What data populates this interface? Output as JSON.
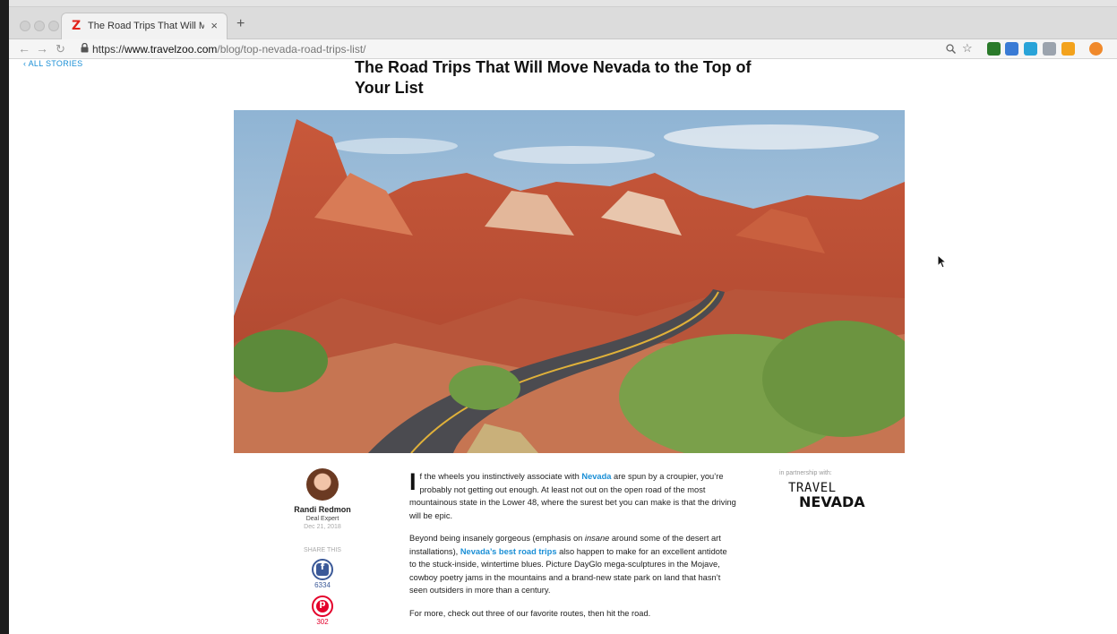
{
  "browser": {
    "tab": {
      "title": "The Road Trips That Will Move",
      "favicon": "Z",
      "close": "×"
    },
    "new_tab": "+",
    "url": {
      "scheme": "https://",
      "host": "www.travelzoo.com",
      "path": "/blog/top-nevada-road-trips-list/"
    }
  },
  "page": {
    "back_link": "ALL STORIES",
    "title": "The Road Trips That Will Move Nevada to the Top of Your List",
    "author": {
      "name": "Randi Redmon",
      "role": "Deal Expert",
      "date": "Dec 21, 2018"
    },
    "share": {
      "label": "SHARE THIS",
      "facebook_count": "6334",
      "pinterest_count": "302"
    },
    "paragraphs": {
      "p1": {
        "dropcap": "I",
        "before": "f the wheels you instinctively associate with ",
        "link": "Nevada",
        "after": " are spun by a croupier, you’re probably not getting out enough. At least not out on the open road of the most mountainous state in the Lower 48, where the surest bet you can make is that the driving will be epic."
      },
      "p2": {
        "before": "Beyond being insanely gorgeous (emphasis on ",
        "em": "insane",
        "mid": " around some of the desert art installations), ",
        "link": "Nevada’s best road trips",
        "after": " also happen to make for an excellent antidote to the stuck-inside, wintertime blues. Picture DayGlo mega-sculptures in the Mojave, cowboy poetry jams in the mountains and a brand-new state park on land that hasn’t seen outsiders in more than a century."
      },
      "p3": "For more, check out three of our favorite routes, then hit the road."
    },
    "partner": {
      "label": "in partnership with:",
      "logo_line1": "TRAVEL",
      "logo_line2": "NEVADA"
    }
  },
  "colors": {
    "link": "#1a8fd6",
    "facebook": "#3b5998",
    "pinterest": "#e4002b",
    "brand": "#e2231a"
  },
  "icons": [
    "back-icon",
    "forward-icon",
    "reload-icon",
    "lock-icon",
    "zoom-icon",
    "bookmark-star-icon",
    "facebook-icon",
    "pinterest-icon",
    "mouse-cursor-icon"
  ]
}
